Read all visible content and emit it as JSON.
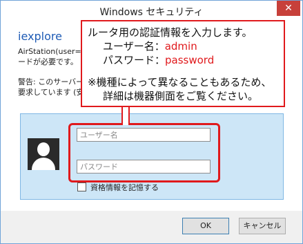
{
  "window": {
    "title": "Windows セキュリティ",
    "close_label": "✕"
  },
  "dialog": {
    "app_name": "iexplore",
    "description_line1": "AirStation(user=",
    "description_line2": "ードが必要です。",
    "warning_line1": "警告: このサーバー",
    "warning_line2": "要求しています (安"
  },
  "credentials": {
    "username_placeholder": "ユーザー名",
    "password_placeholder": "パスワード",
    "remember_label": "資格情報を記憶する"
  },
  "buttons": {
    "ok": "OK",
    "cancel": "キャンセル"
  },
  "callout": {
    "line1": "ルータ用の認証情報を入力します。",
    "user_label": "ユーザー名：",
    "user_value": "admin",
    "pass_label": "パスワード：",
    "pass_value": "password",
    "note1": "※機種によって異なることもあるため、",
    "note2": "詳細は機器側面をご覧ください。"
  }
}
